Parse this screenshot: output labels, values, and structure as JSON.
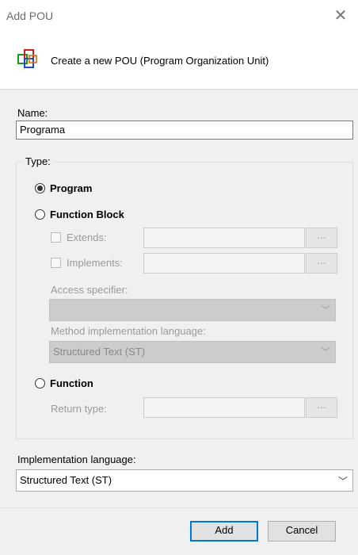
{
  "window": {
    "title": "Add POU",
    "close_glyph": "✕"
  },
  "header": {
    "description": "Create a new POU (Program Organization Unit)",
    "icon": "pou-icon"
  },
  "name": {
    "label": "Name:",
    "value": "Programa"
  },
  "type": {
    "group_label": "Type:",
    "program": {
      "label": "Program",
      "selected": true
    },
    "function_block": {
      "label": "Function Block",
      "selected": false
    },
    "extends": {
      "label": "Extends:",
      "button": "..."
    },
    "implements": {
      "label": "Implements:",
      "button": "..."
    },
    "access_specifier": {
      "label": "Access specifier:",
      "value": ""
    },
    "method_language": {
      "label": "Method implementation language:",
      "value": "Structured Text (ST)"
    },
    "function": {
      "label": "Function",
      "selected": false
    },
    "return_type": {
      "label": "Return type:",
      "button": "..."
    }
  },
  "implementation_language": {
    "label": "Implementation language:",
    "value": "Structured Text (ST)"
  },
  "buttons": {
    "add": "Add",
    "cancel": "Cancel"
  },
  "colors": {
    "accent": "#0078d7",
    "panel": "#f0f0f0",
    "disabled_text": "#9a9a9a"
  }
}
